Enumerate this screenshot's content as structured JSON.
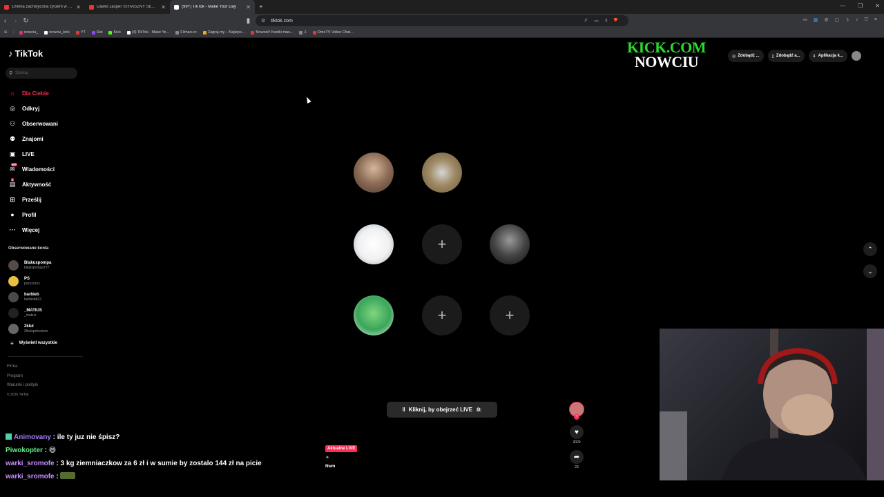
{
  "browser": {
    "tabs": [
      {
        "title": "Chinka zachwycona życiem w Polsce",
        "color": "#e53935",
        "active": false
      },
      {
        "title": "Dawid Jasper STRASZNY SEN - MAFI",
        "color": "#e53935",
        "active": false
      },
      {
        "title": "(99+) TikTok - Make Your Day",
        "color": "#ffffff",
        "active": true
      }
    ],
    "url": "tiktok.com",
    "bookmarks": [
      {
        "label": "nowciu_",
        "color": "#e1306c"
      },
      {
        "label": "nowciu_kick",
        "color": "#ffffff"
      },
      {
        "label": "YT",
        "color": "#e53935"
      },
      {
        "label": "Rat",
        "color": "#9146ff"
      },
      {
        "label": "Kick",
        "color": "#53fc18"
      },
      {
        "label": "(4) TikTok - Make Yo...",
        "color": "#ffffff"
      },
      {
        "label": "Filman.cc",
        "color": "#888888"
      },
      {
        "label": "Zagraj.my – Najleps...",
        "color": "#f5a623"
      },
      {
        "label": "Nowość! Kostki mas...",
        "color": "#e53935"
      },
      {
        "label": "1",
        "color": "#888888"
      },
      {
        "label": "OmeTV Video Chat...",
        "color": "#e53935"
      }
    ]
  },
  "tiktok": {
    "logo": "TikTok",
    "search_placeholder": "Szukaj",
    "nav": [
      {
        "label": "Dla Ciebie",
        "icon": "home-icon",
        "glyph": "⌂",
        "active": true
      },
      {
        "label": "Odkryj",
        "icon": "compass-icon",
        "glyph": "◎"
      },
      {
        "label": "Obserwowani",
        "icon": "following-icon",
        "glyph": "⚇"
      },
      {
        "label": "Znajomi",
        "icon": "friends-icon",
        "glyph": "⚉"
      },
      {
        "label": "LIVE",
        "icon": "live-icon",
        "glyph": "▣"
      },
      {
        "label": "Wiadomości",
        "icon": "messages-icon",
        "glyph": "✉",
        "badge": "99+"
      },
      {
        "label": "Aktywność",
        "icon": "activity-icon",
        "glyph": "▤",
        "badge": "1"
      },
      {
        "label": "Prześlij",
        "icon": "upload-icon",
        "glyph": "⊞"
      },
      {
        "label": "Profil",
        "icon": "profile-icon",
        "glyph": "●"
      },
      {
        "label": "Więcej",
        "icon": "more-icon",
        "glyph": "···"
      }
    ],
    "following_title": "Obserwowane konta",
    "following": [
      {
        "name": "Blakuxpompa",
        "handle": "blejkxpompa777"
      },
      {
        "name": "PS",
        "handle": "pszszszsz"
      },
      {
        "name": "barbieb",
        "handle": "barbiebb22"
      },
      {
        "name": "_MATIUS",
        "handle": "_matius"
      },
      {
        "name": "2klul",
        "handle": "2klulspokoziom"
      }
    ],
    "show_all": "Wyświetl wszystkie",
    "footer": [
      "Firma",
      "Program",
      "Warunki i polityki"
    ],
    "copyright": "© 2026 TikTok",
    "live_button": "Kliknij, by obejrzeć LIVE",
    "live_button_key": "D",
    "live_tag": "Aktualne LIVE",
    "live_name": "Nwm",
    "likes": "3029",
    "shares": "23",
    "top_actions": [
      {
        "label": "Zdobądź ...",
        "icon": "coin-icon"
      },
      {
        "label": "Zdobądź a...",
        "icon": "phone-icon"
      },
      {
        "label": "Aplikacja k...",
        "icon": "download-icon"
      }
    ]
  },
  "overlay": {
    "line1": "KICK.COM",
    "line2": "NOWCIU"
  },
  "chat": [
    {
      "user": "Animovany",
      "message": "ile ty juz nie śpisz?",
      "cls": "u1",
      "icon": true
    },
    {
      "user": "Piwokopter",
      "message": "😄",
      "cls": "u2"
    },
    {
      "user": "warki_sromofe",
      "message": "3 kg ziemniaczkow za 6 zł i w sumie by zostalo 144 zł na picie",
      "cls": "u3"
    },
    {
      "user": "warki_sromofe",
      "message": "",
      "cls": "u3",
      "emote": true
    }
  ]
}
